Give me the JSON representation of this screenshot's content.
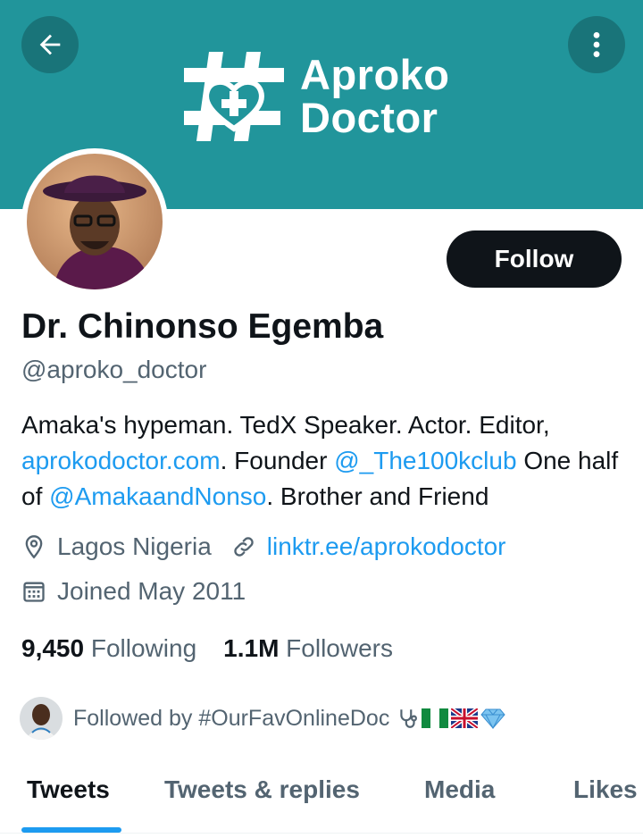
{
  "header": {
    "logo_line1": "Aproko",
    "logo_line2": "Doctor",
    "back_icon": "arrow-left-icon",
    "more_icon": "more-vertical-icon",
    "banner_color": "#21959b"
  },
  "profile": {
    "name": "Dr. Chinonso Egemba",
    "handle": "@aproko_doctor",
    "follow_label": "Follow",
    "bio": {
      "t1": "Amaka's hypeman. TedX Speaker. Actor. Editor,",
      "link1": "aprokodoctor.com",
      "t2": ". Founder ",
      "link2": "@_The100kclub",
      "t3": " One half of ",
      "link3": "@AmakaandNonso",
      "t4": ". Brother and Friend"
    },
    "location": "Lagos Nigeria",
    "website": "linktr.ee/aprokodoctor",
    "joined": "Joined May 2011",
    "following_count": "9,450",
    "following_label": "Following",
    "followers_count": "1.1M",
    "followers_label": "Followers",
    "followed_by": "Followed by #OurFavOnlineDoc"
  },
  "tabs": [
    {
      "label": "Tweets",
      "active": true
    },
    {
      "label": "Tweets & replies",
      "active": false
    },
    {
      "label": "Media",
      "active": false
    },
    {
      "label": "Likes",
      "active": false
    }
  ],
  "colors": {
    "link": "#1d9bf0",
    "secondary_text": "#536471",
    "primary_text": "#0f1419"
  }
}
